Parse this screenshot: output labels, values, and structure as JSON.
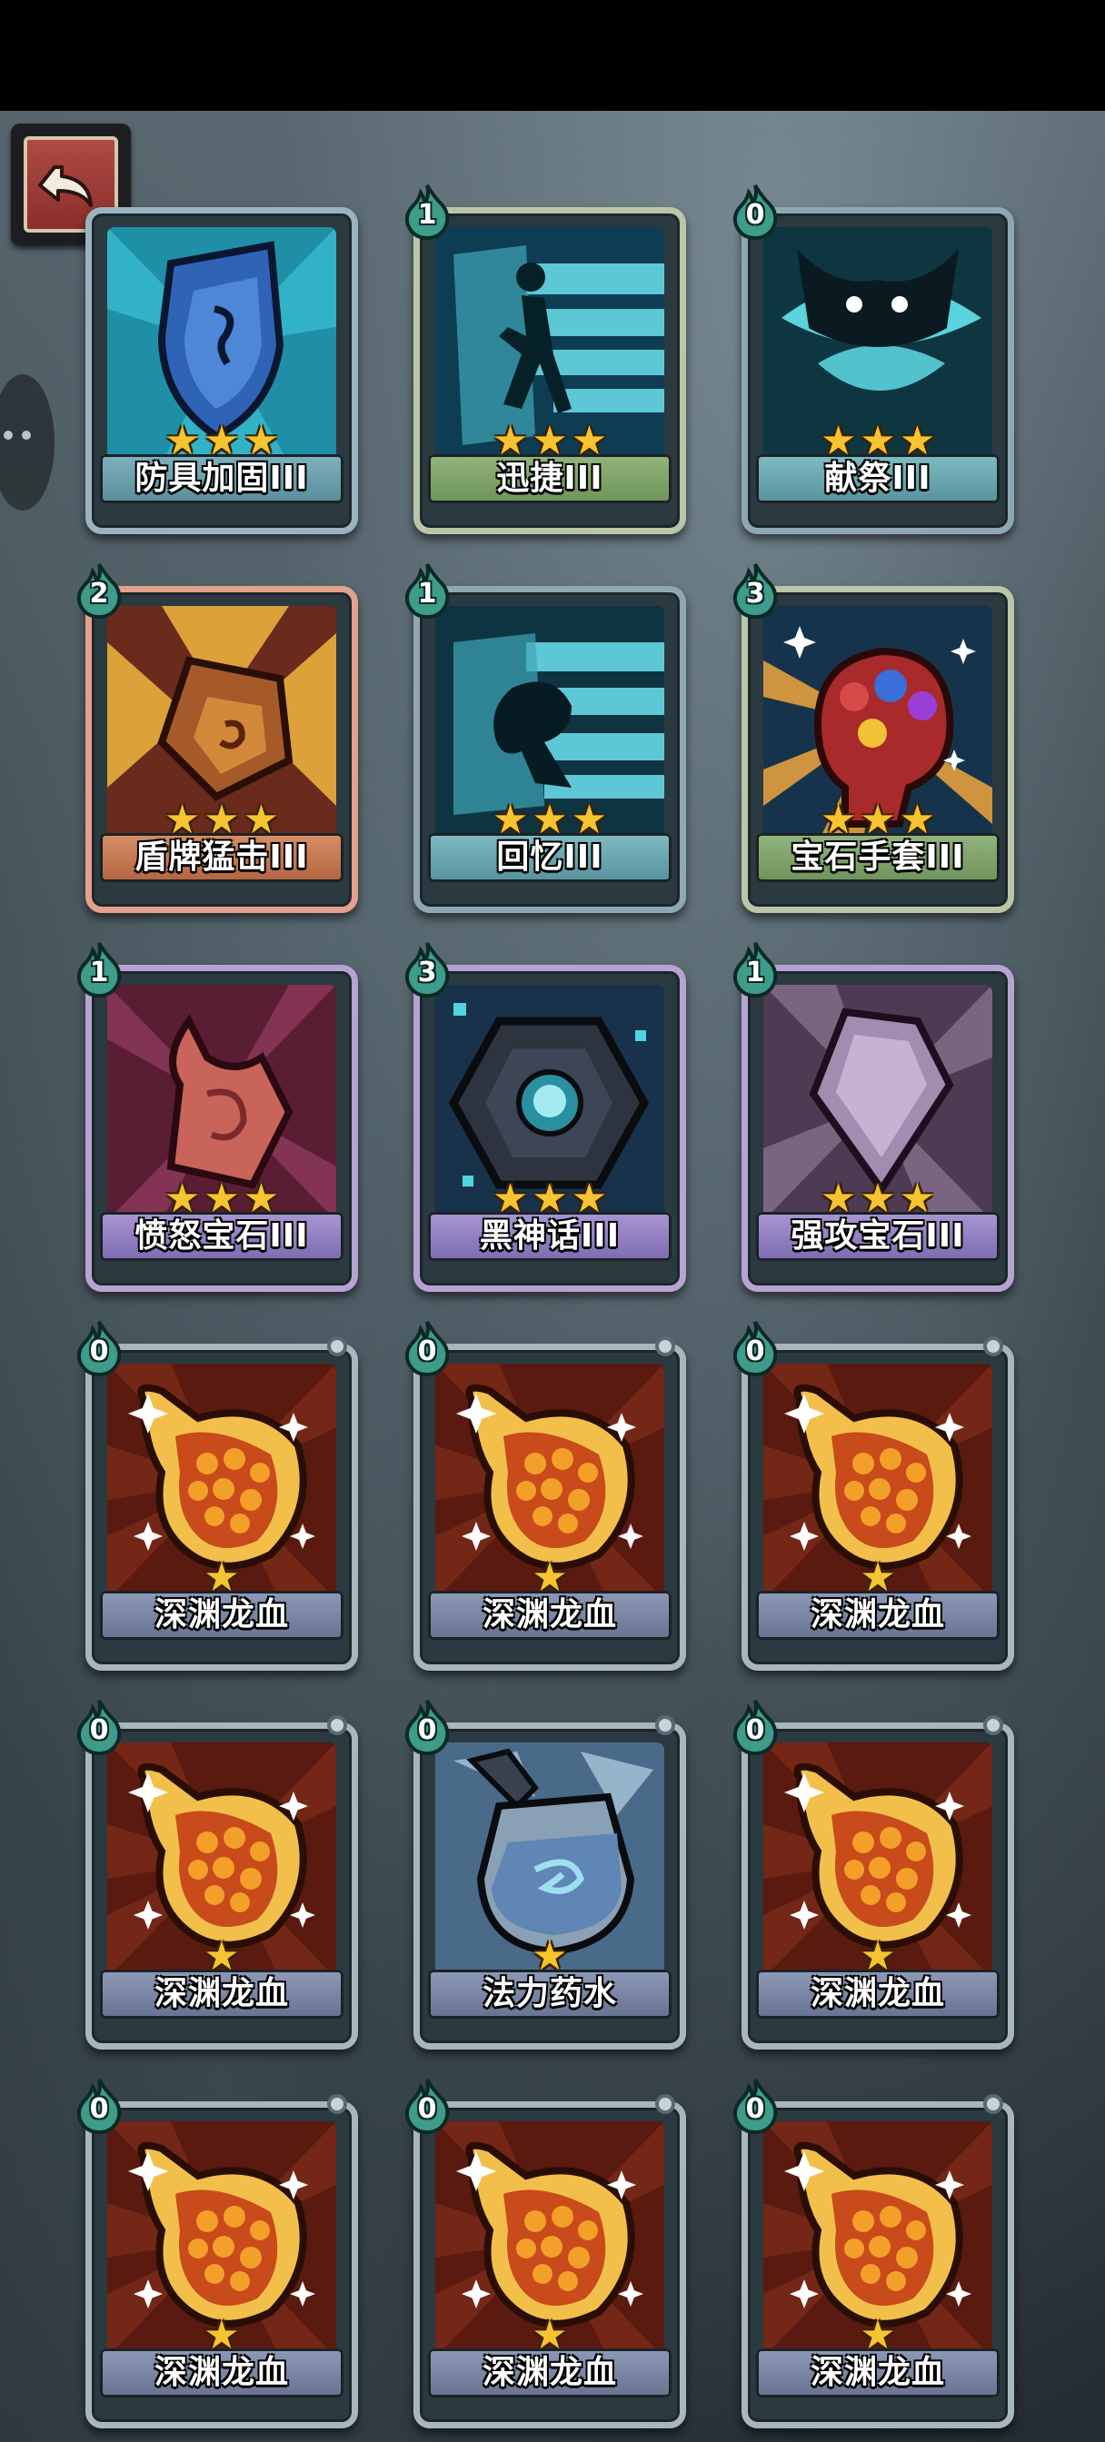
{
  "screen": {
    "back_button": {
      "icon": "return-arrow-icon"
    }
  },
  "cards": [
    {
      "name": "防具加固III",
      "cost": "",
      "stars": 3,
      "rarity": "blue",
      "art": "shield"
    },
    {
      "name": "迅捷III",
      "cost": "1",
      "stars": 3,
      "rarity": "green",
      "art": "runner"
    },
    {
      "name": "献祭III",
      "cost": "0",
      "stars": 3,
      "rarity": "teal",
      "art": "sacrifice"
    },
    {
      "name": "盾牌猛击III",
      "cost": "2",
      "stars": 3,
      "rarity": "red",
      "art": "shield-bash"
    },
    {
      "name": "回忆III",
      "cost": "1",
      "stars": 3,
      "rarity": "teal",
      "art": "memory"
    },
    {
      "name": "宝石手套III",
      "cost": "3",
      "stars": 3,
      "rarity": "green",
      "art": "gauntlet"
    },
    {
      "name": "愤怒宝石III",
      "cost": "1",
      "stars": 3,
      "rarity": "purple",
      "art": "rage-gem"
    },
    {
      "name": "黑神话III",
      "cost": "3",
      "stars": 3,
      "rarity": "purple",
      "art": "black-myth"
    },
    {
      "name": "强攻宝石III",
      "cost": "1",
      "stars": 3,
      "rarity": "purple",
      "art": "assault-gem"
    },
    {
      "name": "深渊龙血",
      "cost": "0",
      "stars": 1,
      "rarity": "grey",
      "art": "dragon-blood"
    },
    {
      "name": "深渊龙血",
      "cost": "0",
      "stars": 1,
      "rarity": "grey",
      "art": "dragon-blood"
    },
    {
      "name": "深渊龙血",
      "cost": "0",
      "stars": 1,
      "rarity": "grey",
      "art": "dragon-blood"
    },
    {
      "name": "深渊龙血",
      "cost": "0",
      "stars": 1,
      "rarity": "grey",
      "art": "dragon-blood"
    },
    {
      "name": "法力药水",
      "cost": "0",
      "stars": 1,
      "rarity": "grey",
      "art": "mana-potion"
    },
    {
      "name": "深渊龙血",
      "cost": "0",
      "stars": 1,
      "rarity": "grey",
      "art": "dragon-blood"
    },
    {
      "name": "深渊龙血",
      "cost": "0",
      "stars": 1,
      "rarity": "grey",
      "art": "dragon-blood"
    },
    {
      "name": "深渊龙血",
      "cost": "0",
      "stars": 1,
      "rarity": "grey",
      "art": "dragon-blood"
    },
    {
      "name": "深渊龙血",
      "cost": "0",
      "stars": 1,
      "rarity": "grey",
      "art": "dragon-blood"
    }
  ],
  "colors": {
    "star": "#f6c431",
    "cost_drop": "#3f9b8a",
    "background": "#3a464d"
  }
}
